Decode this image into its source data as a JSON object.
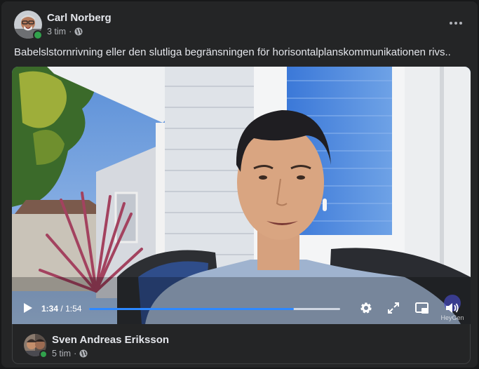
{
  "post": {
    "author": "Carl Norberg",
    "time": "3 tim",
    "separator": "·",
    "text": "Babelslstornrivning eller den slutliga begränsningen  för horisontalplanskommunikationen rivs.."
  },
  "video": {
    "current_time": "1:34",
    "separator": "/",
    "duration": "1:54",
    "progress": 0.815,
    "watermark": "HeyGen"
  },
  "shared": {
    "author": "Sven Andreas Eriksson",
    "time": "5 tim",
    "separator": "·"
  },
  "icons": {
    "more": "more-options-icon",
    "globe": "globe-icon",
    "play": "play-icon",
    "settings": "gear-icon",
    "fullscreen": "fullscreen-icon",
    "pip": "picture-in-picture-icon",
    "volume": "volume-icon"
  },
  "colors": {
    "accent": "#2d88ff",
    "online": "#31a24c",
    "background": "#242526"
  }
}
